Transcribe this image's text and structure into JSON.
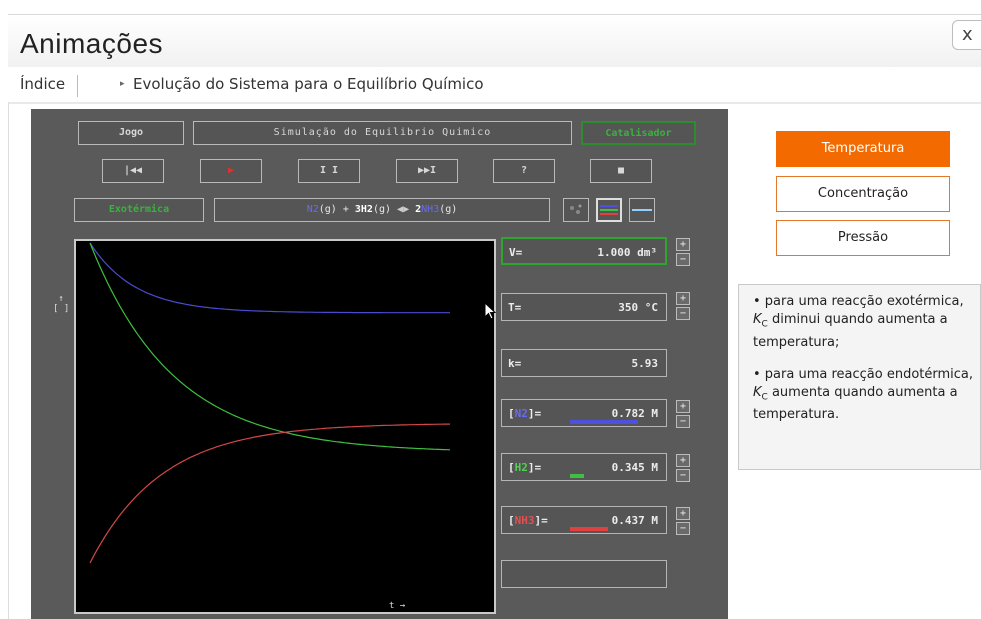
{
  "window": {
    "title": "Animações",
    "close_label": "x"
  },
  "breadcrumb": {
    "root": "Índice",
    "arrow": "▸",
    "current": "Evolução do Sistema para o Equilíbrio Químico"
  },
  "sim": {
    "jogo_label": "Jogo",
    "title_label": "Simulação do Equilibrio Quimico",
    "catalisador_label": "Catalisador",
    "controls": {
      "first": "|◀◀",
      "play": "▶",
      "pause": "I I",
      "last": "▶▶I",
      "help": "?",
      "stop": "■"
    },
    "exotermica_label": "Exotérmica",
    "equation": {
      "n2": "N2",
      "n2_state": "(g) + ",
      "h2": "3H2",
      "h2_state": "(g) ",
      "arrows": "◀▶",
      "nh3_coef": "2",
      "nh3": "NH3",
      "nh3_state": "(g)"
    },
    "fields": {
      "volume_label": "V=",
      "volume_value": "1.000 dm³",
      "temp_label": "T=",
      "temp_value": "350 °C",
      "k_label": "k=",
      "k_value": "5.93",
      "n2_label_open": "[",
      "n2_label": "N2",
      "n2_label_close": "]=",
      "n2_value": "0.782 M",
      "h2_label_open": "[",
      "h2_label": "H2",
      "h2_label_close": "]=",
      "h2_value": "0.345 M",
      "nh3_label_open": "[",
      "nh3_label": "NH3",
      "nh3_label_close": "]=",
      "nh3_value": "0.437 M"
    },
    "plus": "+",
    "minus": "−",
    "y_axis_label": "↑\n[ ]",
    "x_axis_label": "t →"
  },
  "chart_data": {
    "type": "line",
    "xlabel": "t",
    "ylabel": "[ ]",
    "series": [
      {
        "name": "N2",
        "color": "#4b4bd0",
        "start": 1.0,
        "end": 0.782
      },
      {
        "name": "H2",
        "color": "#3fbf3f",
        "start": 1.0,
        "end": 0.345
      },
      {
        "name": "NH3",
        "color": "#d04848",
        "start": 0.0,
        "end": 0.437
      }
    ]
  },
  "panel": {
    "buttons": [
      {
        "label": "Temperatura",
        "active": true
      },
      {
        "label": "Concentração",
        "active": false
      },
      {
        "label": "Pressão",
        "active": false
      }
    ],
    "info": {
      "p1_a": "• para uma reacção exotérmica, ",
      "p1_k": "K",
      "p1_sub": "C",
      "p1_b": " diminui quando aumenta a temperatura;",
      "p2_a": "• para uma reacção endotérmica, ",
      "p2_k": "K",
      "p2_sub": "C",
      "p2_b": " aumenta quando aumenta a temperatura."
    }
  },
  "colors": {
    "accent": "#f26a00",
    "n2": "#4b4bd0",
    "h2": "#3fbf3f",
    "nh3": "#d04848",
    "sim_bg": "#5a5a5a"
  }
}
